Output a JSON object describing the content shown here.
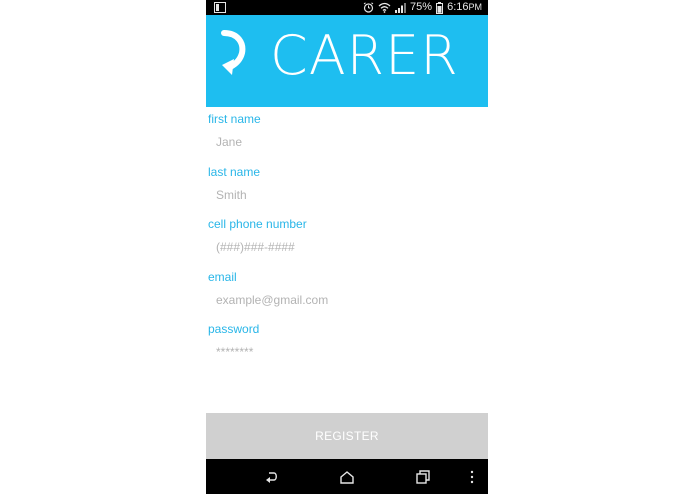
{
  "status_bar": {
    "battery_percent": "75%",
    "time": "6:16",
    "time_suffix": "PM",
    "icons": [
      "screenshot-icon",
      "alarm-icon",
      "wifi-icon",
      "signal-icon",
      "battery-icon"
    ]
  },
  "header": {
    "title": "CARER",
    "background_color": "#1ebef0"
  },
  "form": {
    "fields": [
      {
        "label": "first name",
        "placeholder": "Jane"
      },
      {
        "label": "last name",
        "placeholder": "Smith"
      },
      {
        "label": "cell phone number",
        "placeholder": "(###)###-####"
      },
      {
        "label": "email",
        "placeholder": "example@gmail.com"
      },
      {
        "label": "password",
        "placeholder": "********"
      }
    ],
    "label_color": "#29b6e8"
  },
  "register_button": {
    "label": "REGISTER"
  },
  "nav_bar": {
    "icons": [
      "back-icon",
      "home-icon",
      "recents-icon",
      "menu-icon"
    ]
  }
}
